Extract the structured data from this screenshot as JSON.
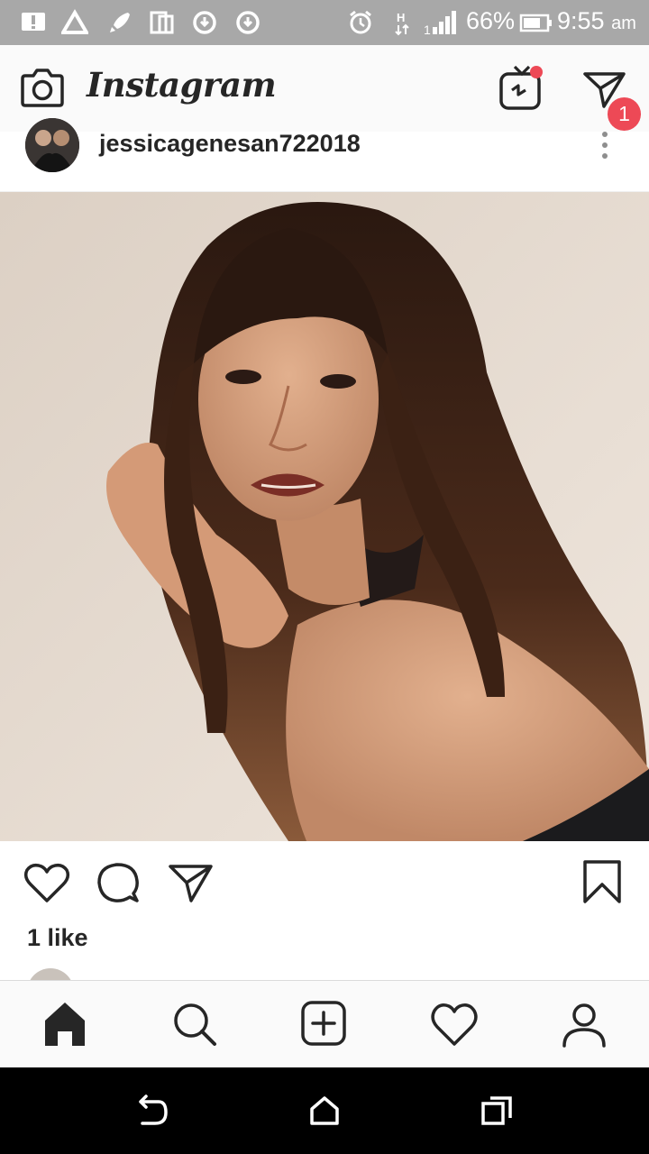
{
  "status_bar": {
    "icons": [
      "alert-icon",
      "drive-icon",
      "rocket-icon",
      "copy-icon",
      "sync-icon",
      "sync-icon",
      "alarm-icon",
      "h-data-icon",
      "signal-icon",
      "battery-icon"
    ],
    "battery": "66%",
    "time": "9:55",
    "ampm": "am"
  },
  "header": {
    "brand": "Instagram",
    "notification_count": "1"
  },
  "post": {
    "username": "jessicagenesan722018",
    "likes": "1 like"
  },
  "bottom_nav": {
    "items": [
      "home-icon",
      "search-icon",
      "new-post-icon",
      "activity-icon",
      "profile-icon"
    ]
  },
  "system_nav": {
    "items": [
      "back-icon",
      "home-icon",
      "recents-icon"
    ]
  },
  "colors": {
    "status_bar": "#a8a8a8",
    "badge": "#ed4956",
    "text": "#262626",
    "photo_background": "#e7ddd2"
  }
}
